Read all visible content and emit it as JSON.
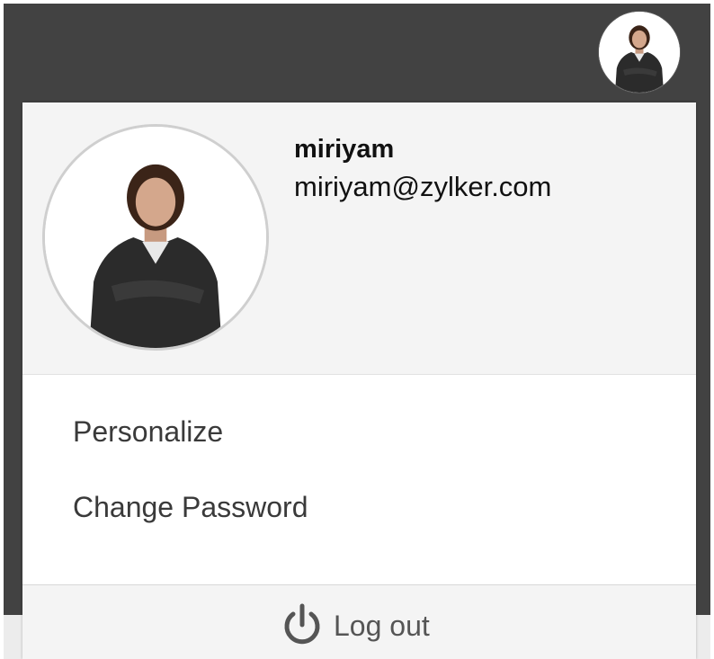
{
  "user": {
    "name": "miriyam",
    "email": "miriyam@zylker.com",
    "avatar": "user-avatar-photo"
  },
  "menu": {
    "personalize_label": "Personalize",
    "change_password_label": "Change Password"
  },
  "logout": {
    "label": "Log out",
    "icon": "power-icon"
  },
  "colors": {
    "topbar": "#424242",
    "panel_header": "#f4f4f4",
    "text": "#3a3a3a"
  }
}
